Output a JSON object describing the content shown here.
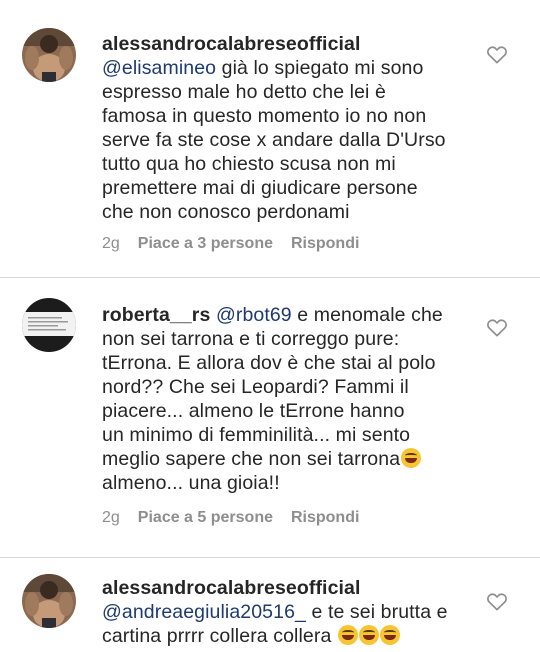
{
  "comments": [
    {
      "username": "alessandrocalabreseofficial",
      "mention": "@elisamineo",
      "lines": [
        " già lo spiegato mi sono",
        "espresso male ho detto che lei è",
        "famosa in questo momento io no non",
        "serve fa ste cose  x andare dalla D'Urso",
        "tutto qua ho chiesto scusa non mi",
        "premettere mai di giudicare persone",
        "che non conosco perdonami"
      ],
      "time": "2g",
      "likes": "Piace a 3 persone",
      "reply": "Rispondi"
    },
    {
      "username": "roberta__rs",
      "mention": "@rbot69",
      "lines": [
        " e menomale che",
        "non sei tarrona e ti correggo pure:",
        "tErrona. E allora dov è che stai al polo",
        "nord?? Che sei Leopardi? Fammi il",
        "piacere... almeno le tErrone hanno",
        "un minimo di femminilità... mi sento",
        "meglio sapere che non sei tarrona",
        "almeno... una gioia!!"
      ],
      "time": "2g",
      "likes": "Piace a 5 persone",
      "reply": "Rispondi"
    },
    {
      "username": "alessandrocalabreseofficial",
      "mention": "@andreaegiulia20516_",
      "lines": [
        " e te sei brutta e",
        "cartina prrrr collera collera"
      ]
    }
  ],
  "icons": {
    "like": "heart-outline-icon",
    "emoji": "grinning-squinting-face-emoji"
  },
  "colors": {
    "text": "#262626",
    "meta": "#8e8e8e",
    "mention": "#1e3a6e",
    "divider": "#d8d8d8",
    "emoji": "#f7c531"
  }
}
